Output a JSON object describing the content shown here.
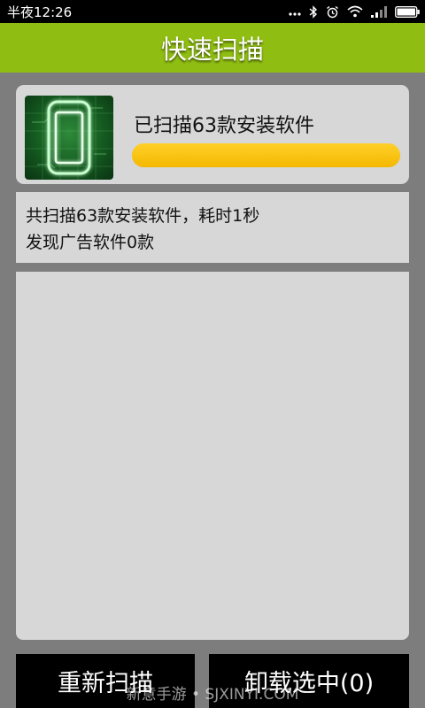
{
  "status_bar": {
    "time": "半夜12:26",
    "icons": [
      "dots-icon",
      "bluetooth-icon",
      "alarm-icon",
      "wifi-icon",
      "signal-icon",
      "battery-icon"
    ]
  },
  "header": {
    "title": "快速扫描",
    "background_color": "#8fbd12"
  },
  "scan_card": {
    "icon": "phone-scan-icon",
    "status_text": "已扫描63款安装软件",
    "progress": 1.0,
    "progress_color": "#fbc200"
  },
  "summary": {
    "line1": "共扫描63款安装软件，耗时1秒",
    "line2": "发现广告软件0款"
  },
  "actions": {
    "rescan_label": "重新扫描",
    "uninstall_selected_label": "卸载选中(0)"
  },
  "watermark": "新意手游 • SJXINYI.COM"
}
